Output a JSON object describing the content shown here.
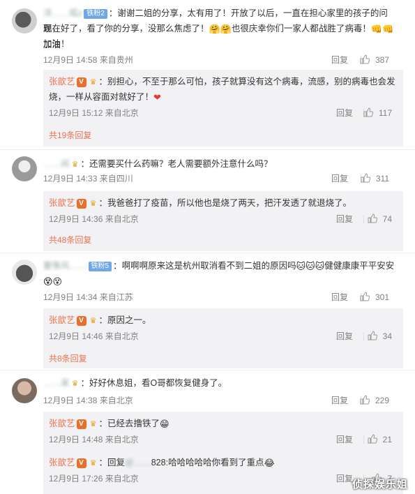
{
  "comments": [
    {
      "user": "洋……呱z",
      "badge": "铁粉2",
      "text": "：谢谢二姐的分享，太有用了！开放了以后，一直在担心家里的孩子的问题，",
      "text2_a": "现在好了，看了你的分享，没那么焦虑了！",
      "text2_b": "也很庆幸你们一家人都战胜了病毒！",
      "text2_c": "加油",
      "text3": "加油！",
      "time": "12月9日 14:58 来自贵州",
      "reply_label": "回复",
      "likes": "387",
      "sub": [
        {
          "user": "张歆艺",
          "text": "：别担心，不至于那么可怕，孩子就算没有这个病毒，流感，别的病毒也会发",
          "text2": "烧，一样从容面对就好了！",
          "time": "12月9日 15:12 来自北京",
          "reply_label": "回复",
          "likes": "117"
        }
      ],
      "more": "共19条回复"
    },
    {
      "user": "……间",
      "text": "：还需要买什么药嘛？老人需要额外注意什么吗？",
      "time": "12月9日 14:33 来自四川",
      "reply_label": "回复",
      "likes": "311",
      "sub": [
        {
          "user": "张歆艺",
          "text": "：我爸爸打了疫苗，所以他也是烧了两天，把汗发透了就退烧了。",
          "time": "12月9日 14:36 来自北京",
          "reply_label": "回复",
          "likes": "74"
        }
      ],
      "more": "共48条回复"
    },
    {
      "user": "要等风……",
      "badge": "铁粉5",
      "text": "：啊啊啊原来这是杭州取消看不到二姐的原因吗",
      "text_b": "健健康康平平安安",
      "time": "12月9日 14:34 来自江苏",
      "reply_label": "回复",
      "likes": "301",
      "sub": [
        {
          "user": "张歆艺",
          "text": "：原因之一。",
          "time": "12月9日 14:46 来自北京",
          "reply_label": "回复",
          "likes": "34"
        }
      ],
      "more": "共8条回复"
    },
    {
      "user": "……呆",
      "text": "：好好休息姐，看O哥都恢复健身了。",
      "time": "12月9日 14:38 来自北京",
      "reply_label": "回复",
      "likes": "229",
      "sub": [
        {
          "user": "张歆艺",
          "text": "：已经去撸铁了",
          "time": "12月9日 14:48 来自北京",
          "reply_label": "回复",
          "likes": "21"
        },
        {
          "user": "张歆艺",
          "text_a": "：回复",
          "text_mention": "@……",
          "text_b": "828:哈哈哈哈哈你看到了重点",
          "time": "12月9日 17:26 来自北京",
          "reply_label": "回复",
          "likes": "7"
        }
      ]
    }
  ],
  "watermark": "侦探娱乐姐",
  "icons": {
    "thumb": "thumbs-up-icon",
    "verified": "verified-v-icon",
    "crown": "crown-icon"
  },
  "colors": {
    "username": "#eb7350",
    "meta": "#808080",
    "subbox": "#f2f2f5"
  }
}
